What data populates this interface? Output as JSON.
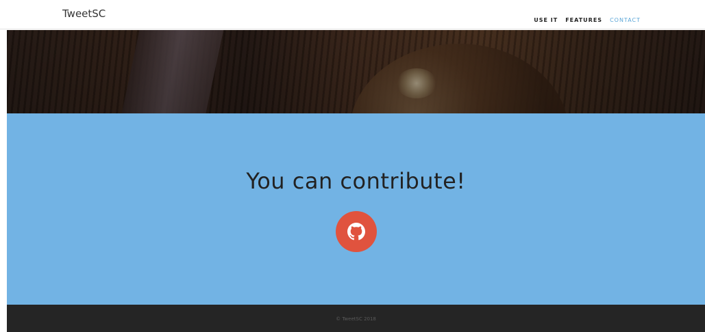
{
  "navbar": {
    "brand": "TweetSC",
    "links": [
      {
        "label": "USE IT",
        "active": false
      },
      {
        "label": "FEATURES",
        "active": false
      },
      {
        "label": "CONTACT",
        "active": true
      }
    ]
  },
  "contribute": {
    "heading": "You can contribute!",
    "button_icon": "github-icon"
  },
  "footer": {
    "copyright": "© TweetSC 2018"
  },
  "colors": {
    "accent_blue": "#72b3e4",
    "link_active": "#5aa6d8",
    "button_red": "#e0533e",
    "footer_bg": "#252525"
  }
}
